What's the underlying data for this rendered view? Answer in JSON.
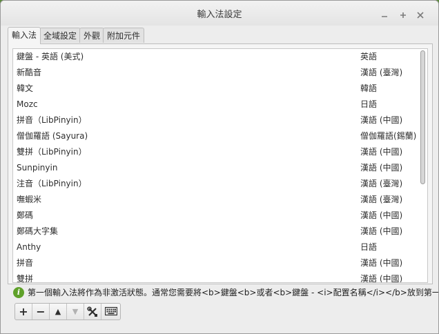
{
  "window": {
    "title": "輸入法設定"
  },
  "tabs": [
    {
      "label": "輸入法"
    },
    {
      "label": "全域設定"
    },
    {
      "label": "外觀"
    },
    {
      "label": "附加元件"
    }
  ],
  "input_methods": [
    {
      "name": "鍵盤 - 英語 (美式)",
      "language": "英語"
    },
    {
      "name": "新酷音",
      "language": "漢語 (臺灣)"
    },
    {
      "name": "韓文",
      "language": "韓語"
    },
    {
      "name": "Mozc",
      "language": "日語"
    },
    {
      "name": "拼音（LibPinyin）",
      "language": "漢語 (中國)"
    },
    {
      "name": "僧伽羅語 (Sayura)",
      "language": "僧伽羅語(錫蘭)"
    },
    {
      "name": "雙拼（LibPinyin）",
      "language": "漢語 (中國)"
    },
    {
      "name": "Sunpinyin",
      "language": "漢語 (中國)"
    },
    {
      "name": "注音（LibPinyin）",
      "language": "漢語 (臺灣)"
    },
    {
      "name": "嘸蝦米",
      "language": "漢語 (臺灣)"
    },
    {
      "name": "鄭碼",
      "language": "漢語 (中國)"
    },
    {
      "name": "鄭碼大字集",
      "language": "漢語 (中國)"
    },
    {
      "name": "Anthy",
      "language": "日語"
    },
    {
      "name": "拼音",
      "language": "漢語 (中國)"
    },
    {
      "name": "雙拼",
      "language": "漢語 (中國)"
    }
  ],
  "info": {
    "icon": "info-icon",
    "message": "第一個輸入法將作為非激活狀態。通常您需要將<b>鍵盤<b>或者<b>鍵盤 - <i>配置名稱</i></b>放到第一個。"
  },
  "toolbar": {
    "add_label": "+",
    "remove_label": "−",
    "up_label": "▲",
    "down_label": "▼"
  },
  "colors": {
    "desktop": "#5a8a3a",
    "window_bg": "#ededed",
    "info_icon": "#5fa12a"
  }
}
